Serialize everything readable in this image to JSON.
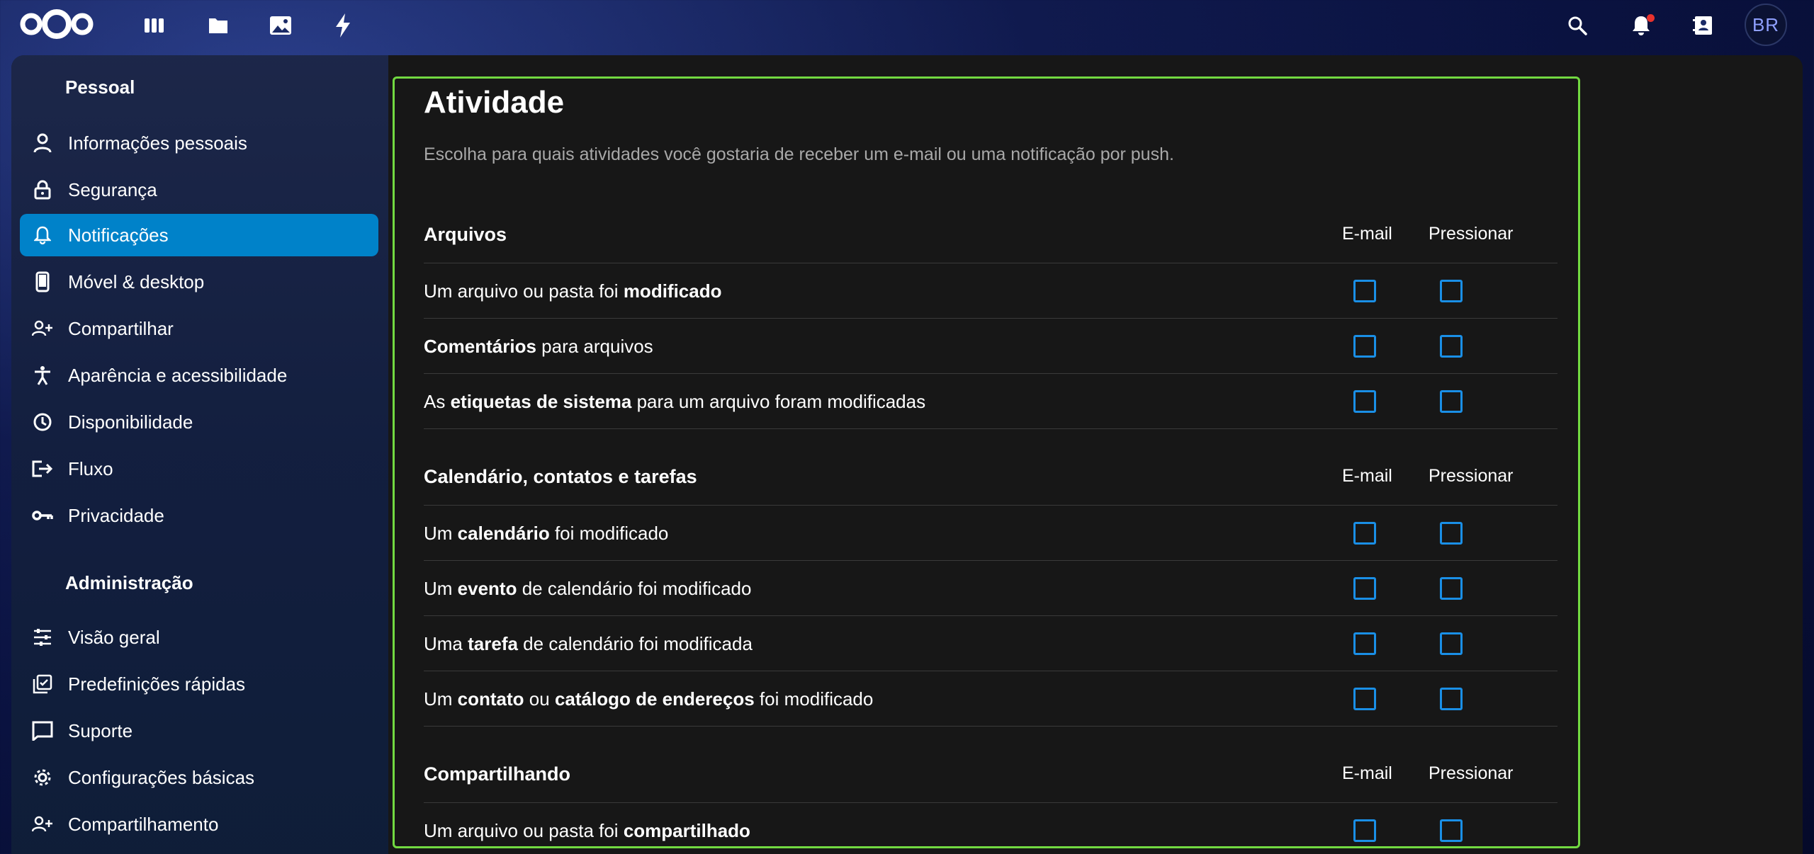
{
  "topbar": {
    "apps": [
      {
        "name": "dashboard-icon"
      },
      {
        "name": "files-icon"
      },
      {
        "name": "photos-icon"
      },
      {
        "name": "activity-icon"
      }
    ],
    "avatar_initials": "BR"
  },
  "sidebar": {
    "personal_caption": "Pessoal",
    "personal_items": [
      {
        "label": "Informações pessoais",
        "icon": "user-icon"
      },
      {
        "label": "Segurança",
        "icon": "lock-icon"
      },
      {
        "label": "Notificações",
        "icon": "bell-icon",
        "active": true
      },
      {
        "label": "Móvel & desktop",
        "icon": "phone-icon"
      },
      {
        "label": "Compartilhar",
        "icon": "share-user-icon"
      },
      {
        "label": "Aparência e acessibilidade",
        "icon": "accessibility-icon"
      },
      {
        "label": "Disponibilidade",
        "icon": "clock-icon"
      },
      {
        "label": "Fluxo",
        "icon": "flow-icon"
      },
      {
        "label": "Privacidade",
        "icon": "key-icon"
      }
    ],
    "admin_caption": "Administração",
    "admin_items": [
      {
        "label": "Visão geral",
        "icon": "sliders-icon"
      },
      {
        "label": "Predefinições rápidas",
        "icon": "presets-icon"
      },
      {
        "label": "Suporte",
        "icon": "support-icon"
      },
      {
        "label": "Configurações básicas",
        "icon": "gear-icon"
      },
      {
        "label": "Compartilhamento",
        "icon": "share-user-icon"
      }
    ]
  },
  "main": {
    "title": "Atividade",
    "subtitle": "Escolha para quais atividades você gostaria de receber um e-mail ou uma notificação por push.",
    "col_email": "E-mail",
    "col_push": "Pressionar",
    "groups": [
      {
        "label": "Arquivos",
        "rows": [
          {
            "pre": "Um arquivo ou pasta foi ",
            "bold": "modificado",
            "post": ""
          },
          {
            "pre": "",
            "bold": "Comentários",
            "post": " para arquivos"
          },
          {
            "pre": "As ",
            "bold": "etiquetas de sistema",
            "post": " para um arquivo foram modificadas"
          }
        ]
      },
      {
        "label": "Calendário, contatos e tarefas",
        "rows": [
          {
            "pre": "Um ",
            "bold": "calendário",
            "post": " foi modificado"
          },
          {
            "pre": "Um ",
            "bold": "evento",
            "post": " de calendário foi modificado"
          },
          {
            "pre": "Uma ",
            "bold": "tarefa",
            "post": " de calendário foi modificada"
          },
          {
            "pre": "Um ",
            "bold": "contato",
            "mid": " ou ",
            "bold2": "catálogo de endereços",
            "post": " foi modificado"
          }
        ]
      },
      {
        "label": "Compartilhando",
        "rows": [
          {
            "pre": "Um arquivo ou pasta foi ",
            "bold": "compartilhado",
            "post": ""
          }
        ]
      }
    ]
  }
}
